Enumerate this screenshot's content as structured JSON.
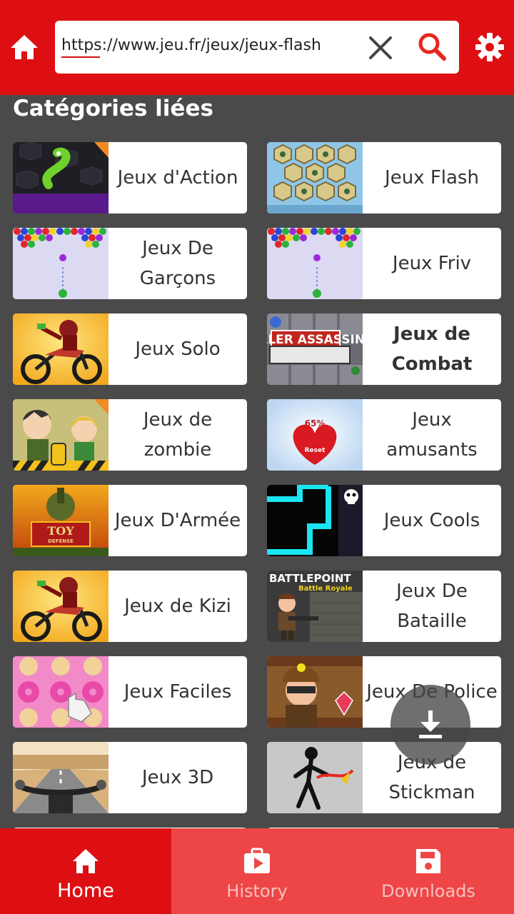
{
  "topbar": {
    "url": "https://www.jeu.fr/jeux/jeux-flash",
    "colors": {
      "primary": "#dd0f12",
      "secondary": "#ee4646"
    }
  },
  "section": {
    "title": "Catégories liées"
  },
  "categories": [
    {
      "label": "Jeux d'Action",
      "thumb": "slither-io-thumbnail",
      "bold": false
    },
    {
      "label": "Jeux Flash",
      "thumb": "hex-puzzle-thumbnail",
      "bold": false
    },
    {
      "label": "Jeux De Garçons",
      "thumb": "bubble-shooter-thumbnail",
      "bold": false
    },
    {
      "label": "Jeux Friv",
      "thumb": "bubble-shooter-thumbnail",
      "bold": false
    },
    {
      "label": "Jeux Solo",
      "thumb": "motocross-thumbnail",
      "bold": false
    },
    {
      "label": "Jeux de Combat",
      "thumb": "killer-assassin-thumbnail",
      "thumb_text": "KILLER ASSASSIN",
      "bold": true
    },
    {
      "label": "Jeux de zombie",
      "thumb": "zombie-game-thumbnail",
      "bold": false
    },
    {
      "label": "Jeux amusants",
      "thumb": "heart-reset-thumbnail",
      "thumb_text": "65%",
      "thumb_text2": "Reset",
      "bold": false
    },
    {
      "label": "Jeux D'Armée",
      "thumb": "toy-defense-thumbnail",
      "thumb_text": "TOY",
      "thumb_text2": "DEFENSE",
      "bold": false
    },
    {
      "label": "Jeux Cools",
      "thumb": "neon-maze-thumbnail",
      "bold": false
    },
    {
      "label": "Jeux de Kizi",
      "thumb": "motocross-thumbnail",
      "bold": false
    },
    {
      "label": "Jeux De Bataille",
      "thumb": "battlepoint-thumbnail",
      "thumb_text": "BATTLEPOINT",
      "thumb_text2": "Battle Royale",
      "bold": false
    },
    {
      "label": "Jeux Faciles",
      "thumb": "donut-match-thumbnail",
      "bold": false
    },
    {
      "label": "Jeux De Police",
      "thumb": "robber-thumbnail",
      "bold": false
    },
    {
      "label": "Jeux 3D",
      "thumb": "moto-road-thumbnail",
      "bold": false
    },
    {
      "label": "Jeux de Stickman",
      "thumb": "stickman-thumbnail",
      "bold": false
    }
  ],
  "fab": {
    "icon": "download-icon"
  },
  "bottom_nav": [
    {
      "label": "Home",
      "icon": "home-icon",
      "active": true
    },
    {
      "label": "History",
      "icon": "briefcase-play-icon",
      "active": false
    },
    {
      "label": "Downloads",
      "icon": "save-icon",
      "active": false
    }
  ]
}
